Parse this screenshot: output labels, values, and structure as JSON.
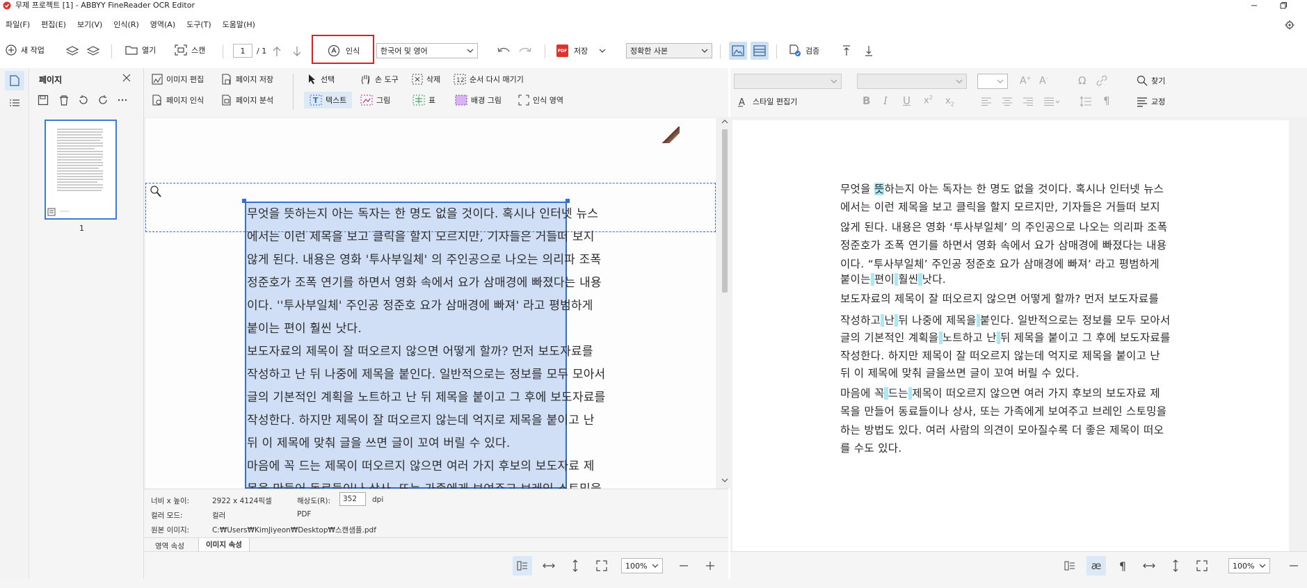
{
  "window": {
    "title": "무제 프로젝트 [1] - ABBYY FineReader OCR Editor"
  },
  "menu": [
    "파일(F)",
    "편집(E)",
    "보기(V)",
    "인식(R)",
    "영역(A)",
    "도구(T)",
    "도움말(H)"
  ],
  "toolbar": {
    "new_task": "새 작업",
    "open": "열기",
    "scan": "스캔",
    "page_current": "1",
    "page_total": "/ 1",
    "recognize": "인식",
    "language": "한국어 및 영어",
    "save": "저장",
    "save_badge": "PDF",
    "save_mode": "정확한 사본",
    "verify": "검증"
  },
  "page_panel": {
    "title": "페이지",
    "thumbnail_number": "1"
  },
  "image_tools": {
    "edit_image": "이미지 편집",
    "save_page": "페이지 저장",
    "recognize_page": "페이지 인식",
    "analyze_page": "페이지 분석",
    "select": "선택",
    "hand_tool": "손 도구",
    "delete": "삭제",
    "reorder": "순서 다시 매기기",
    "text": "텍스트",
    "picture": "그림",
    "table": "표",
    "background_picture": "배경 그림",
    "recognition_area": "인식 영역"
  },
  "text_tools": {
    "find": "찾기",
    "style_editor": "스타일 편집기",
    "proofread": "교정"
  },
  "scan_lines": [
    "무엇을 뜻하는지 아는 독자는 한 명도 없을 것이다. 혹시나 인터넷 뉴스",
    "에서는 이런 제목을 보고 클릭을 할지 모르지만, 기자들은 거들떠 보지",
    "않게 된다. 내용은 영화 '투사부일체' 의 주인공으로 나오는 의리파 조폭",
    "정준호가 조폭 연기를 하면서 영화 속에서 요가 삼매경에 빠졌다는 내용",
    "이다. ''투사부일체' 주인공 정준호 요가 삼매경에 빠져' 라고 평범하게",
    "붙이는 편이 훨씬 낫다.",
    "  보도자료의 제목이 잘 떠오르지 않으면 어떻게 할까? 먼저 보도자료를",
    "작성하고 난 뒤 나중에 제목을 붙인다. 일반적으로는 정보를 모두 모아서",
    "글의 기본적인 계획을 노트하고 난 뒤 제목을 붙이고 그 후에 보도자료를",
    "작성한다. 하지만 제목이 잘 떠오르지 않는데 억지로 제목을 붙이고 난",
    "뒤 이 제목에 맞춰 글을 쓰면 글이 꼬여 버릴 수 있다.",
    "  마음에 꼭 드는 제목이 떠오르지 않으면 여러 가지 후보의 보도자료 제",
    "목을 만들어 동료들이나 상사, 또는 가족에게 보여주고 브레인 스토밍을"
  ],
  "properties": {
    "size_label": "너비 x 높이:",
    "size_value": "2922 x 4124픽셀",
    "resolution_label": "해상도(R):",
    "resolution_value": "352",
    "resolution_unit": "dpi",
    "color_label": "컬러 모드:",
    "color_value": "컬러",
    "format_value": "PDF",
    "source_label": "원본 이미지:",
    "source_value": "C:₩Users₩KimJiyeon₩Desktop₩스캔샘플.pdf",
    "tab_area": "영역 속성",
    "tab_image": "이미지 속성"
  },
  "text_lines": [
    [
      {
        "t": "무엇을 "
      },
      {
        "t": "뜻",
        "h": 1
      },
      {
        "t": "하는지 아는 독자는 한 명도 없을 것이다. 혹시나 인터넷 뉴스"
      }
    ],
    [
      {
        "t": "에서는 이런 제목을 보고 클릭을 할지 모르지만, 기자들은 거들떠 보지"
      }
    ],
    [
      {
        "t": "않게 된다. 내용은 영화 ‘투사부일체’ 의 주인공으로 나오는 의리파 조폭"
      }
    ],
    [
      {
        "t": "정준호가 조폭 연기를 하면서 영화 속에서 요가 삼매경에 빠졌다는 내용"
      }
    ],
    [
      {
        "t": "이다. “투사부일체’ 주인공 정준호 요가 삼매경에 빠져’ 라고 평범하게"
      }
    ],
    [
      {
        "t": "붙이는"
      },
      {
        "t": " ",
        "h": 1
      },
      {
        "t": "편이"
      },
      {
        "t": " ",
        "h": 1
      },
      {
        "t": "훨씬"
      },
      {
        "t": " ",
        "h": 1
      },
      {
        "t": "낫다."
      }
    ],
    [
      {
        "t": "  보도자료의 제목이 잘 떠오르지 않으면 어떻게 할까? 먼저 보도자료를"
      }
    ],
    [
      {
        "t": "작성하고"
      },
      {
        "t": " ",
        "h": 1
      },
      {
        "t": "난"
      },
      {
        "t": " ",
        "h": 1
      },
      {
        "t": "뒤 나중에 제목을"
      },
      {
        "t": " ",
        "h": 1
      },
      {
        "t": "붙인다. 일반적으로는 정보를 모두 모아서"
      }
    ],
    [
      {
        "t": "글의 기본적인 계획을"
      },
      {
        "t": " ",
        "h": 1
      },
      {
        "t": "노트하고 난"
      },
      {
        "t": " ",
        "h": 1
      },
      {
        "t": "뒤 제목을 붙이고 그 후에 보도자료를"
      }
    ],
    [
      {
        "t": "작성한다. 하지만 제목이 잘 떠오르지 않는데 억지로 제목을 붙이고 난"
      }
    ],
    [
      {
        "t": "뒤 이 제목에 맞춰 글을쓰면 글이 꼬여 버릴 수 있다."
      }
    ],
    [
      {
        "t": "  마음에 꼭"
      },
      {
        "t": " ",
        "h": 1
      },
      {
        "t": "드는"
      },
      {
        "t": " ",
        "h": 1
      },
      {
        "t": "제목이 떠오르지 않으면 여러 가지 후보의 보도자료 제"
      }
    ],
    [
      {
        "t": "목을 만들어 동료들이나 상사, 또는 가족에게 보여주고 브레인 스토밍을"
      }
    ],
    [
      {
        "t": "하는 방법도 있다. 여러 사람의 의견이 모아질수록 더 좋은 제목이 떠오"
      }
    ],
    [
      {
        "t": "를 수도 있다."
      }
    ]
  ],
  "zoom": {
    "image_zoom": "100%",
    "text_zoom": "100%"
  },
  "colors": {
    "accent": "#2f6fd6",
    "highlight": "#a9e9f5",
    "recognize_box": "#e02020"
  }
}
